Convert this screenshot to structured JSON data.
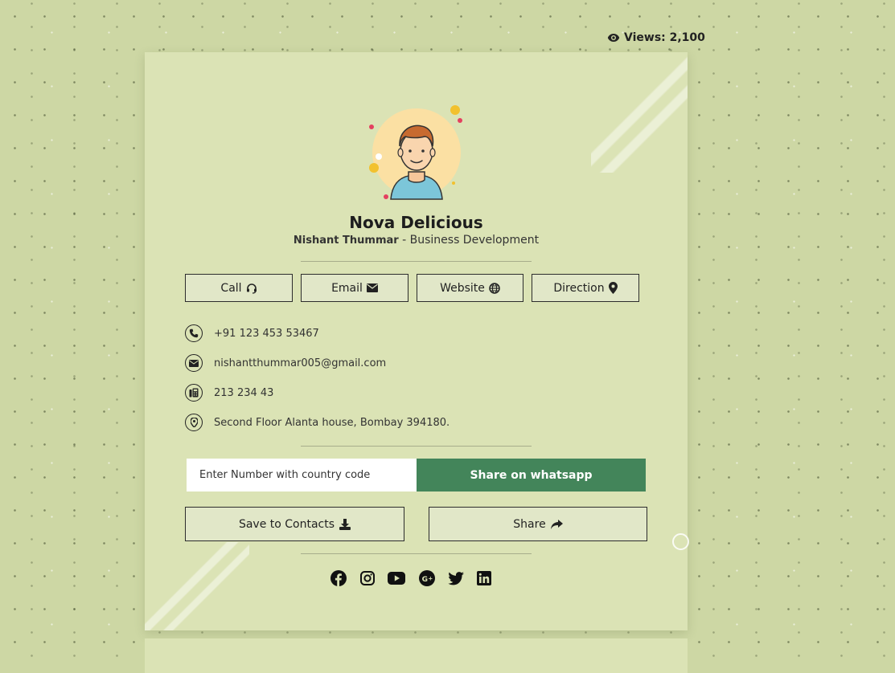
{
  "views": {
    "label": "Views: 2,100",
    "icon": "eye-icon"
  },
  "profile": {
    "company": "Nova Delicious",
    "name": "Nishant Thummar",
    "separator": " - ",
    "role": "Business Development",
    "avatar_icon": "avatar-illustration"
  },
  "actions": {
    "call": {
      "label": "Call",
      "icon": "headset-icon"
    },
    "email": {
      "label": "Email",
      "icon": "envelope-icon"
    },
    "website": {
      "label": "Website",
      "icon": "globe-icon"
    },
    "direction": {
      "label": "Direction",
      "icon": "map-pin-icon"
    }
  },
  "contacts": {
    "phone": {
      "value": "+91 123 453 53467",
      "icon": "phone-icon"
    },
    "email": {
      "value": "nishantthummar005@gmail.com",
      "icon": "envelope-icon"
    },
    "fax": {
      "value": "213 234 43",
      "icon": "fax-icon"
    },
    "address": {
      "value": "Second Floor Alanta house, Bombay 394180.",
      "icon": "map-pin-icon"
    }
  },
  "whatsapp": {
    "placeholder": "Enter Number with country code",
    "button_label": "Share on whatsapp"
  },
  "save": {
    "label": "Save to Contacts",
    "icon": "download-icon"
  },
  "share": {
    "label": "Share",
    "icon": "share-arrow-icon"
  },
  "social": [
    "facebook-icon",
    "instagram-icon",
    "youtube-icon",
    "google-plus-icon",
    "twitter-icon",
    "linkedin-icon"
  ],
  "colors": {
    "background": "#cdd7a4",
    "card": "#dbe3b5",
    "button_bg": "#e1e7c8",
    "whatsapp_green": "#43855a"
  }
}
